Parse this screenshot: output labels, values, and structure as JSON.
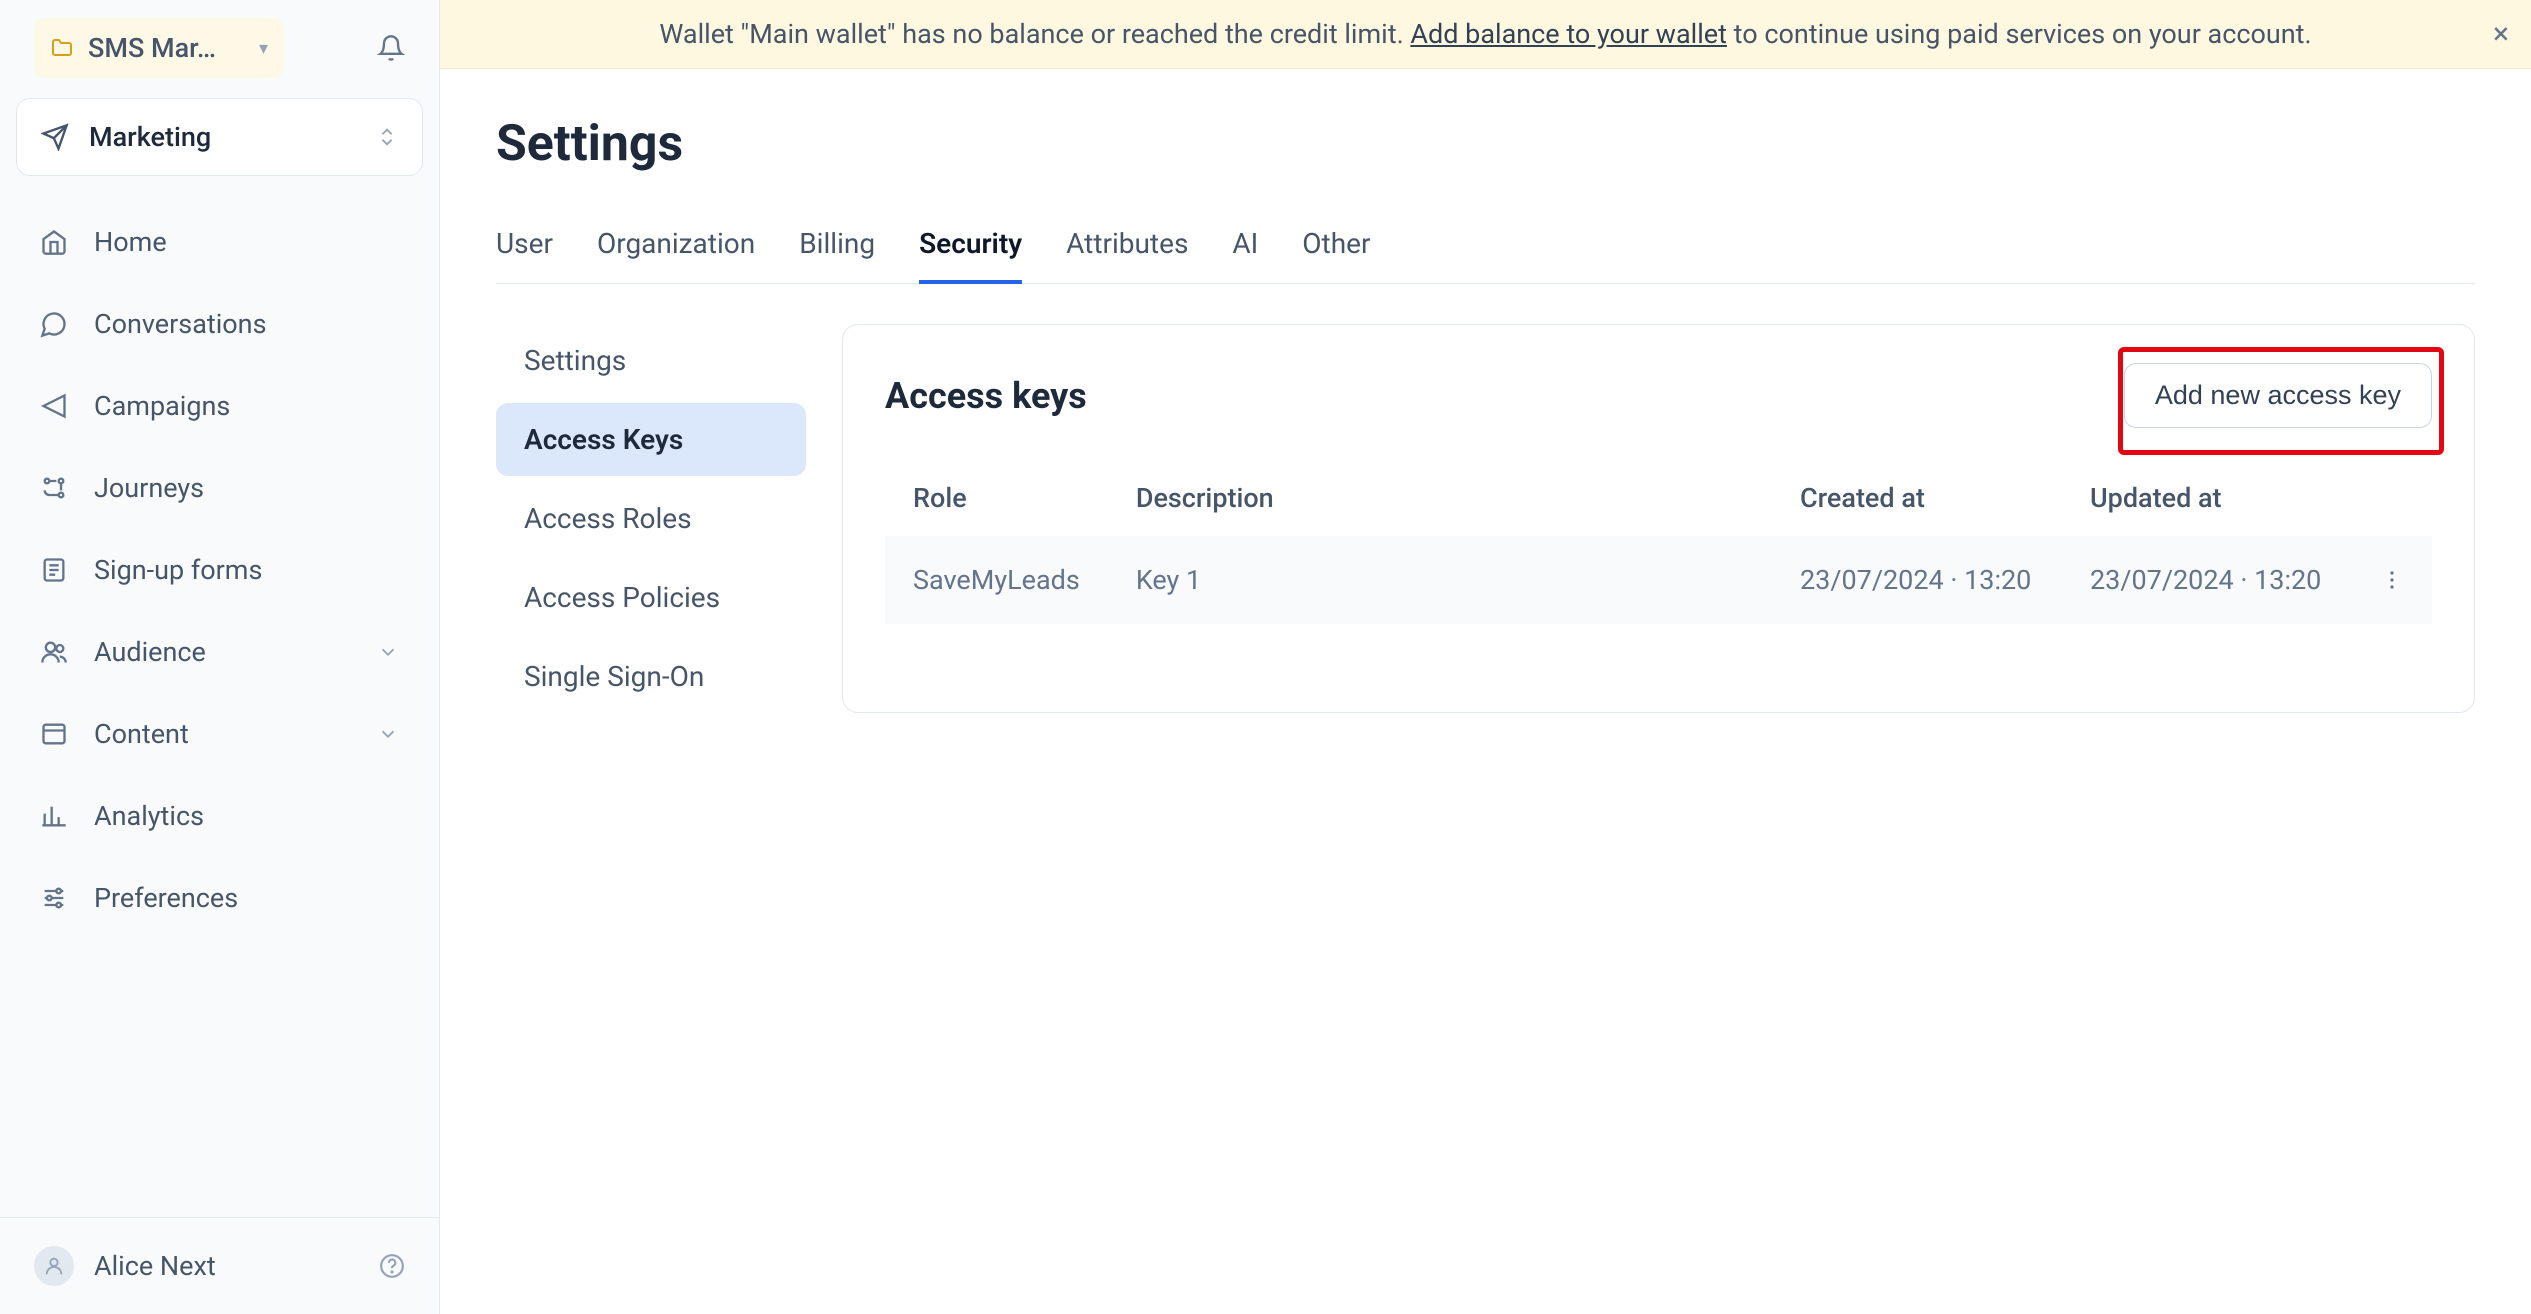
{
  "project": {
    "name": "SMS Mar…"
  },
  "navSelector": {
    "label": "Marketing"
  },
  "sidebar": {
    "items": [
      {
        "label": "Home"
      },
      {
        "label": "Conversations"
      },
      {
        "label": "Campaigns"
      },
      {
        "label": "Journeys"
      },
      {
        "label": "Sign-up forms"
      },
      {
        "label": "Audience"
      },
      {
        "label": "Content"
      },
      {
        "label": "Analytics"
      },
      {
        "label": "Preferences"
      }
    ]
  },
  "user": {
    "name": "Alice Next"
  },
  "banner": {
    "textBefore": "Wallet \"Main wallet\" has no balance or reached the credit limit. ",
    "linkText": "Add balance to your wallet",
    "textAfter": " to continue using paid services on your account."
  },
  "page": {
    "title": "Settings"
  },
  "tabs": [
    {
      "label": "User"
    },
    {
      "label": "Organization"
    },
    {
      "label": "Billing"
    },
    {
      "label": "Security"
    },
    {
      "label": "Attributes"
    },
    {
      "label": "AI"
    },
    {
      "label": "Other"
    }
  ],
  "subnav": [
    {
      "label": "Settings"
    },
    {
      "label": "Access Keys"
    },
    {
      "label": "Access Roles"
    },
    {
      "label": "Access Policies"
    },
    {
      "label": "Single Sign-On"
    }
  ],
  "panel": {
    "title": "Access keys",
    "addButton": "Add new access key",
    "columns": {
      "role": "Role",
      "description": "Description",
      "created": "Created at",
      "updated": "Updated at"
    },
    "rows": [
      {
        "role": "SaveMyLeads",
        "description": "Key 1",
        "created": "23/07/2024 · 13:20",
        "updated": "23/07/2024 · 13:20"
      }
    ]
  }
}
